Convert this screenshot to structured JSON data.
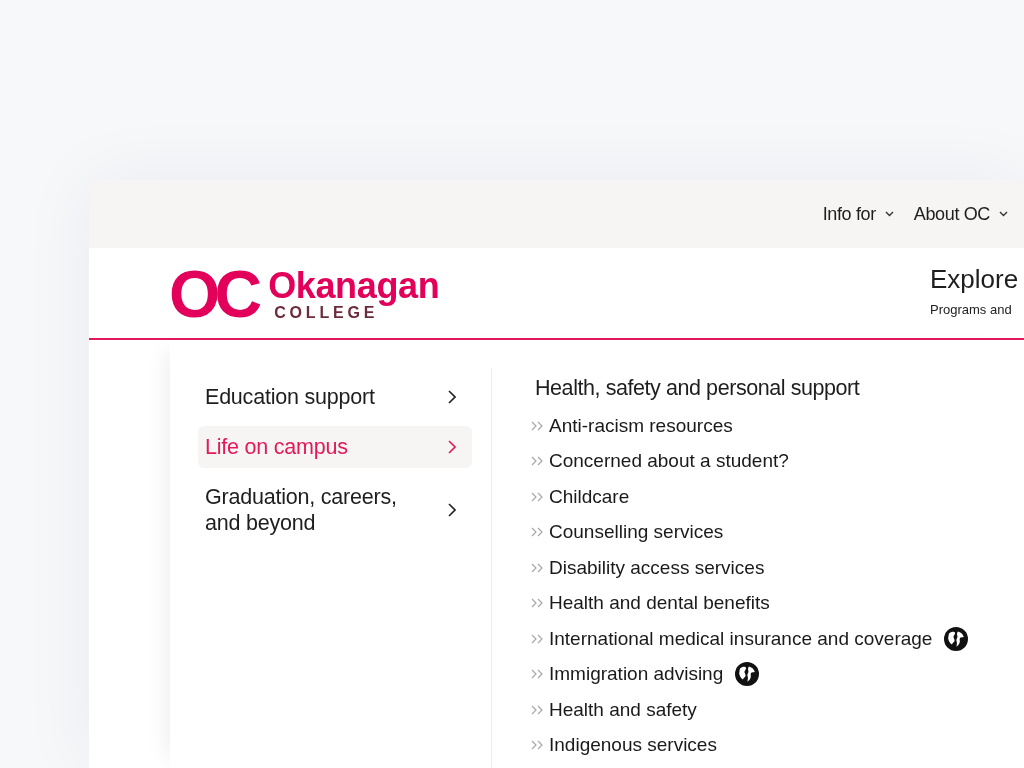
{
  "top_nav": [
    {
      "label": "Info for"
    },
    {
      "label": "About OC"
    }
  ],
  "logo": {
    "mark": "OC",
    "name": "Okanagan",
    "subtitle": "COLLEGE"
  },
  "explore": {
    "title": "Explore",
    "subtitle": "Programs and"
  },
  "menu": {
    "items": [
      {
        "label": "Education support",
        "selected": false
      },
      {
        "label": "Life on campus",
        "selected": true
      },
      {
        "label": "Graduation, careers, and beyond",
        "selected": false
      }
    ]
  },
  "section": {
    "heading": "Health, safety and personal support",
    "links": [
      {
        "label": "Anti-racism resources",
        "globe": false
      },
      {
        "label": "Concerned about a student?",
        "globe": false
      },
      {
        "label": "Childcare",
        "globe": false
      },
      {
        "label": "Counselling services",
        "globe": false
      },
      {
        "label": "Disability access services",
        "globe": false
      },
      {
        "label": "Health and dental benefits",
        "globe": false
      },
      {
        "label": "International medical insurance and coverage",
        "globe": true
      },
      {
        "label": "Immigration advising",
        "globe": true
      },
      {
        "label": "Health and safety",
        "globe": false
      },
      {
        "label": "Indigenous services",
        "globe": false
      }
    ]
  }
}
